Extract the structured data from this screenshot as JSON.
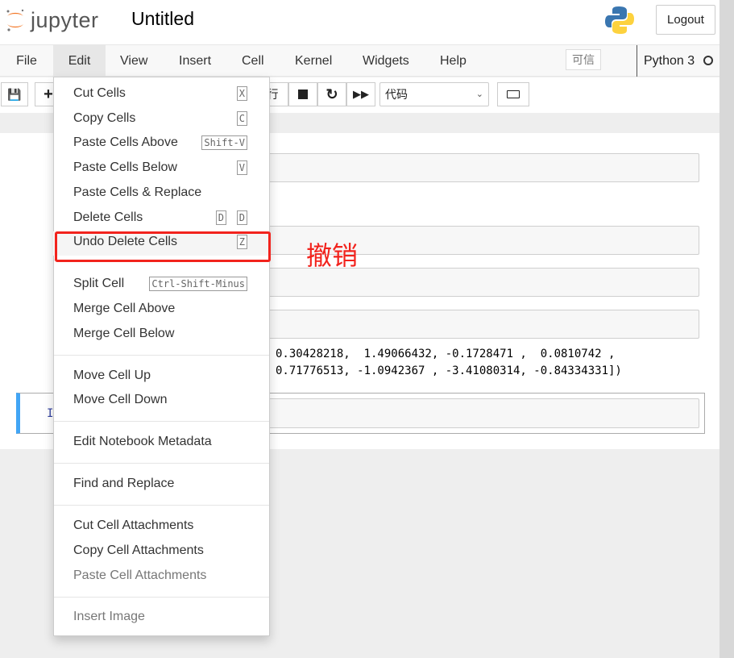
{
  "header": {
    "logo_text": "jupyter",
    "title": "Untitled",
    "logout_label": "Logout"
  },
  "menubar": {
    "items": [
      "File",
      "Edit",
      "View",
      "Insert",
      "Cell",
      "Kernel",
      "Widgets",
      "Help"
    ],
    "trusted": "可信",
    "kernel": "Python 3"
  },
  "toolbar": {
    "run_partial": "行",
    "cell_type": "代码"
  },
  "notebook": {
    "output_lines": [
      "0.30428218,  1.49066432, -0.1728471 ,  0.0810742 ,",
      "0.71776513, -1.0942367 , -3.41080314, -0.84334331])"
    ],
    "prompt": "I"
  },
  "edit_menu": {
    "items": [
      {
        "label": "Cut Cells",
        "shortcut": "X"
      },
      {
        "label": "Copy Cells",
        "shortcut": "C"
      },
      {
        "label": "Paste Cells Above",
        "shortcut": "Shift-V"
      },
      {
        "label": "Paste Cells Below",
        "shortcut": "V"
      },
      {
        "label": "Paste Cells & Replace"
      },
      {
        "label": "Delete Cells",
        "shortcut": "D",
        "shortcut2": "D"
      },
      {
        "label": "Undo Delete Cells",
        "shortcut": "Z"
      },
      {
        "label": "Split Cell",
        "shortcut": "Ctrl-Shift-Minus"
      },
      {
        "label": "Merge Cell Above"
      },
      {
        "label": "Merge Cell Below"
      },
      {
        "label": "Move Cell Up"
      },
      {
        "label": "Move Cell Down"
      },
      {
        "label": "Edit Notebook Metadata"
      },
      {
        "label": "Find and Replace"
      },
      {
        "label": "Cut Cell Attachments"
      },
      {
        "label": "Copy Cell Attachments"
      },
      {
        "label": "Paste Cell Attachments",
        "disabled": true
      },
      {
        "label": "Insert Image",
        "disabled": true
      }
    ]
  },
  "annotation": {
    "text": "撤销",
    "color": "#f2231d"
  },
  "colors": {
    "accent": "#42a5f5",
    "highlight": "#f2231d",
    "logo": "#f37726"
  }
}
